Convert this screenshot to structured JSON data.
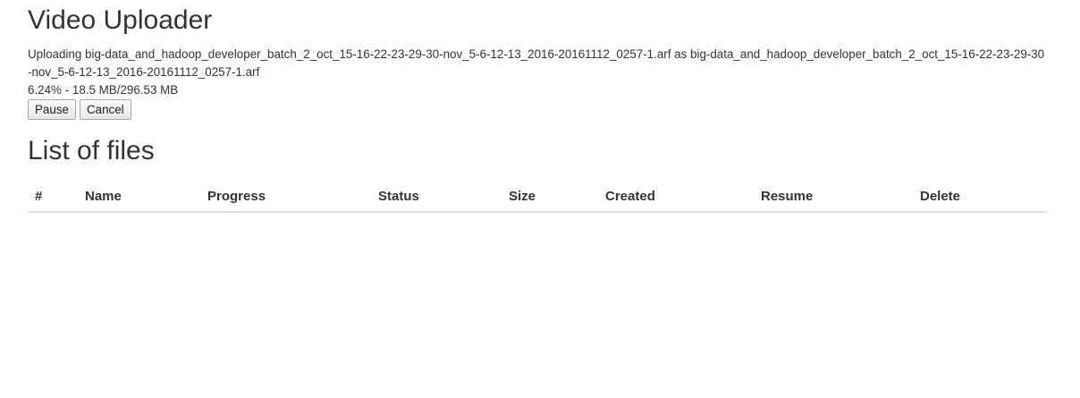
{
  "title": "Video Uploader",
  "upload": {
    "status_text": "Uploading big-data_and_hadoop_developer_batch_2_oct_15-16-22-23-29-30-nov_5-6-12-13_2016-20161112_0257-1.arf as big-data_and_hadoop_developer_batch_2_oct_15-16-22-23-29-30-nov_5-6-12-13_2016-20161112_0257-1.arf",
    "progress_text": "6.24% - 18.5 MB/296.53 MB",
    "pause_label": "Pause",
    "cancel_label": "Cancel"
  },
  "files": {
    "heading": "List of files",
    "columns": [
      "#",
      "Name",
      "Progress",
      "Status",
      "Size",
      "Created",
      "Resume",
      "Delete"
    ],
    "rows": []
  }
}
